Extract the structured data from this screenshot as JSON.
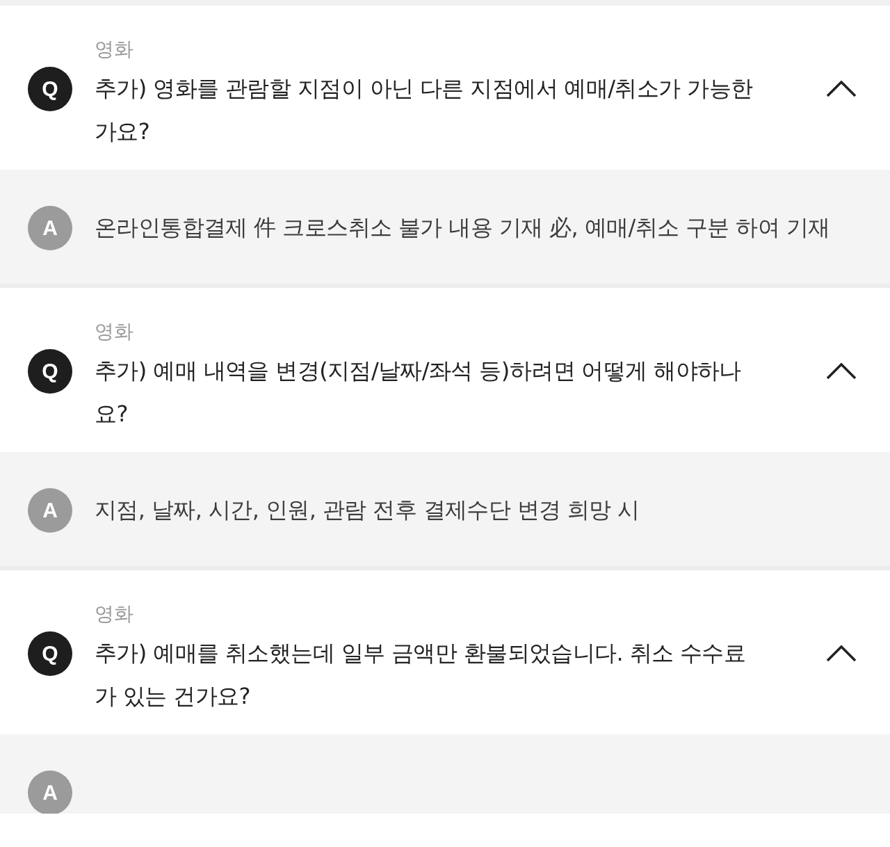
{
  "faq_items": [
    {
      "category": "영화",
      "question_mark": "Q",
      "question": "추가) 영화를 관람할 지점이 아닌 다른 지점에서 예매/취소가 가능한가요?",
      "expanded": true,
      "answer_mark": "A",
      "answer": "온라인통합결제 件 크로스취소 불가 내용 기재 必, 예매/취소 구분 하여 기재"
    },
    {
      "category": "영화",
      "question_mark": "Q",
      "question": "추가) 예매 내역을 변경(지점/날짜/좌석 등)하려면 어떻게 해야하나요?",
      "expanded": true,
      "answer_mark": "A",
      "answer": "지점, 날짜, 시간, 인원, 관람 전후 결제수단 변경 희망 시"
    },
    {
      "category": "영화",
      "question_mark": "Q",
      "question": "추가) 예매를 취소했는데 일부 금액만 환불되었습니다. 취소 수수료가 있는 건가요?",
      "expanded": true,
      "answer_mark": "A"
    }
  ]
}
